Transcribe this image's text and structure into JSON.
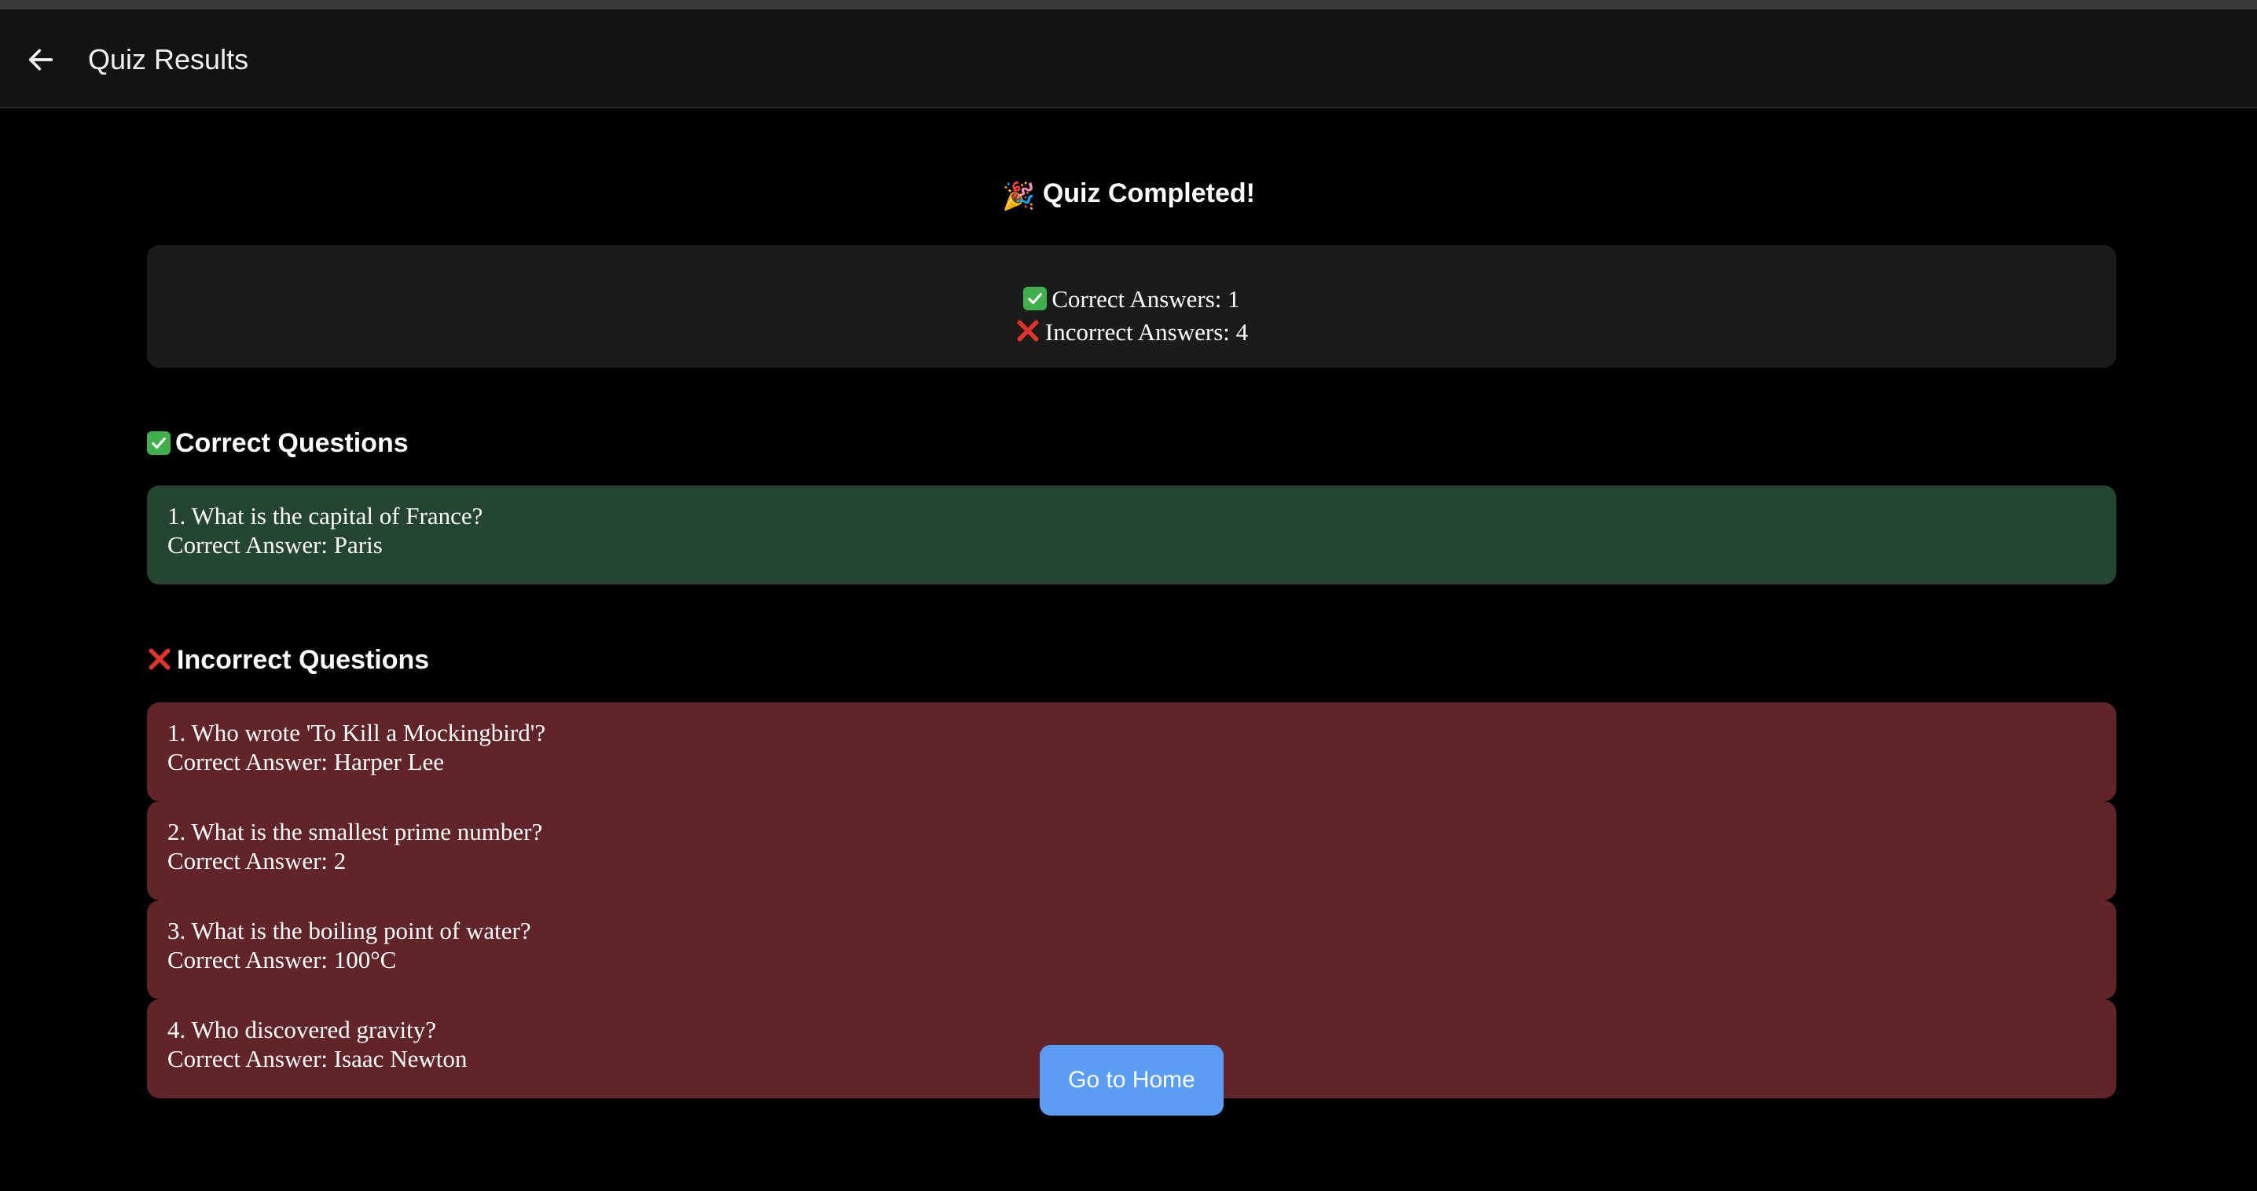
{
  "appbar": {
    "back_icon": "arrow-left-icon",
    "title": "Quiz Results"
  },
  "heading": {
    "emoji": "🎉",
    "text": "Quiz Completed!"
  },
  "summary": {
    "correct_label": "Correct Answers: 1",
    "incorrect_label": "Incorrect Answers: 4"
  },
  "correct_section": {
    "title": "Correct Questions",
    "items": [
      {
        "question": "1. What is the capital of France?",
        "answer": "Correct Answer: Paris"
      }
    ]
  },
  "incorrect_section": {
    "title": "Incorrect Questions",
    "items": [
      {
        "question": "1. Who wrote 'To Kill a Mockingbird'?",
        "answer": "Correct Answer: Harper Lee"
      },
      {
        "question": "2. What is the smallest prime number?",
        "answer": "Correct Answer: 2"
      },
      {
        "question": "3. What is the boiling point of water?",
        "answer": "Correct Answer: 100°C"
      },
      {
        "question": "4. Who discovered gravity?",
        "answer": "Correct Answer: Isaac Newton"
      }
    ]
  },
  "home_button": {
    "label": "Go to Home"
  },
  "colors": {
    "background": "#000000",
    "appbar": "#131313",
    "summary_card": "#1b1b1b",
    "correct_card": "#234532",
    "incorrect_card": "#612428",
    "primary_button": "#5b9cf4",
    "check_green": "#3fb04c",
    "cross_red": "#e0342b"
  }
}
